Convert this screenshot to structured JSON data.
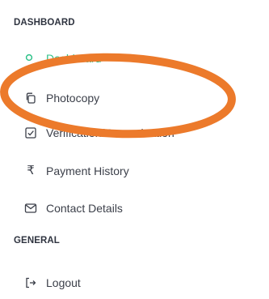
{
  "sidebar": {
    "sections": [
      {
        "title": "DASHBOARD",
        "items": [
          {
            "label": "Dashboard",
            "icon": "dashboard-icon",
            "active": true
          },
          {
            "label": "Photocopy",
            "icon": "copy-icon"
          },
          {
            "label": "Verification/Re-evaluation",
            "icon": "checkbox-icon"
          },
          {
            "label": "Payment History",
            "icon": "rupee-icon"
          },
          {
            "label": "Contact Details",
            "icon": "envelope-icon"
          }
        ]
      },
      {
        "title": "GENERAL",
        "items": [
          {
            "label": "Logout",
            "icon": "logout-icon"
          }
        ]
      }
    ],
    "rupee_symbol": "₹"
  },
  "colors": {
    "active": "#30c28a",
    "text": "#3b3f49",
    "annotation": "#ec7a2b"
  }
}
